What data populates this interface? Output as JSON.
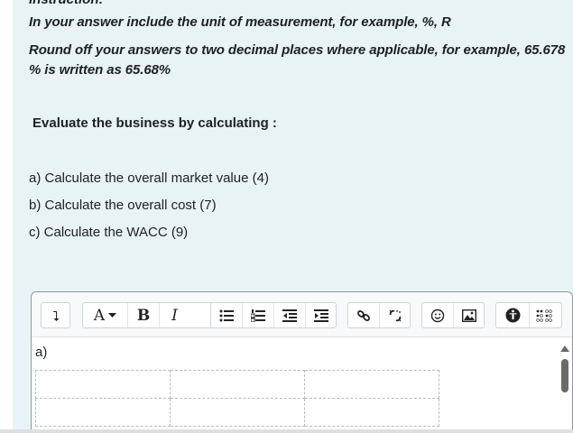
{
  "question": {
    "cut_title": "Instruction:",
    "instruction_1": "In your answer include the unit of measurement, for example, %, R",
    "instruction_2": "Round off your answers to two decimal places where applicable, for example, 65.678 % is written as 65.68%",
    "heading": "Evaluate the business by calculating :",
    "items": [
      "a)  Calculate the overall market value (4)",
      "b)  Calculate the overall cost (7)",
      "c)   Calculate the WACC (9)"
    ]
  },
  "editor": {
    "toolbar": {
      "font_size_label": "A",
      "bold_label": "B",
      "italic_label": "I"
    },
    "content": {
      "paragraph": "a)"
    }
  },
  "colors": {
    "question_bg": "#e7f3f5",
    "editor_border": "#8f959e",
    "toolbar_bg": "#f8f9fa"
  }
}
